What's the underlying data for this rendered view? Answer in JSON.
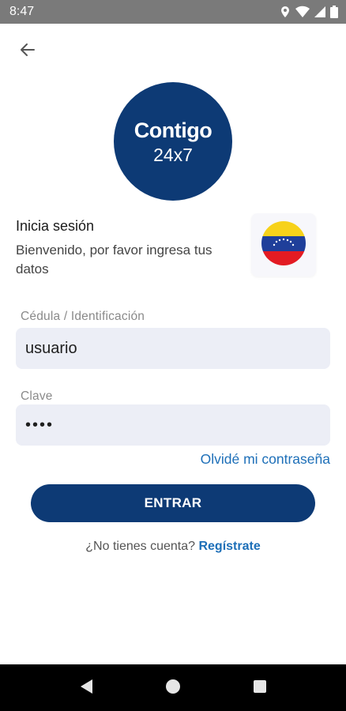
{
  "status_bar": {
    "time": "8:47",
    "icons": [
      "location-icon",
      "wifi-icon",
      "signal-icon",
      "battery-icon"
    ]
  },
  "header": {
    "back_icon": "arrow-left-icon"
  },
  "logo": {
    "line1": "Contigo",
    "line2": "24x7",
    "color": "#0d3a75"
  },
  "login": {
    "title": "Inicia sesión",
    "subtitle": "Bienvenido, por favor ingresa tus datos",
    "country_flag": "venezuela-flag-icon"
  },
  "form": {
    "id_label": "Cédula / Identificación",
    "id_value": "usuario",
    "password_label": "Clave",
    "password_value": "••••",
    "forgot_link": "Olvidé mi contraseña",
    "submit_label": "ENTRAR",
    "no_account_text": "¿No tienes cuenta?",
    "register_link": "Regístrate"
  },
  "colors": {
    "primary": "#0d3a75",
    "link": "#1d6fb8",
    "field_bg": "#eceef6"
  },
  "nav_bar": {
    "icons": [
      "back-triangle-icon",
      "home-circle-icon",
      "recents-square-icon"
    ]
  }
}
